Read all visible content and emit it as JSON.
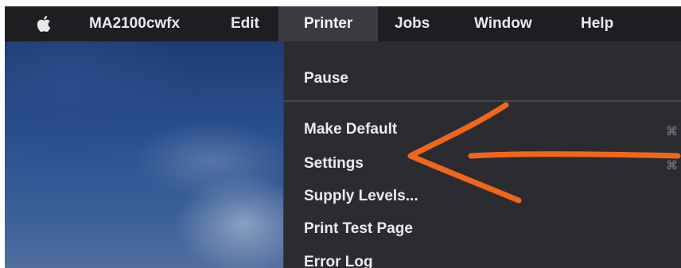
{
  "menubar": {
    "apple_icon": "apple-icon",
    "app_name": "MA2100cwfx",
    "items": {
      "edit": "Edit",
      "printer": "Printer",
      "jobs": "Jobs",
      "window": "Window",
      "help": "Help"
    }
  },
  "printer_menu": {
    "pause": "Pause",
    "make_default": "Make Default",
    "settings": "Settings",
    "supply_levels": "Supply Levels...",
    "print_test_page": "Print Test Page",
    "error_log": "Error Log"
  },
  "colors": {
    "menubar_bg": "#1d1e22",
    "menu_bg": "#2b2c30",
    "highlight_bg": "#3a3b40",
    "annotation": "#f0661a"
  },
  "icons": [
    "apple-icon",
    "command-key-icon"
  ]
}
